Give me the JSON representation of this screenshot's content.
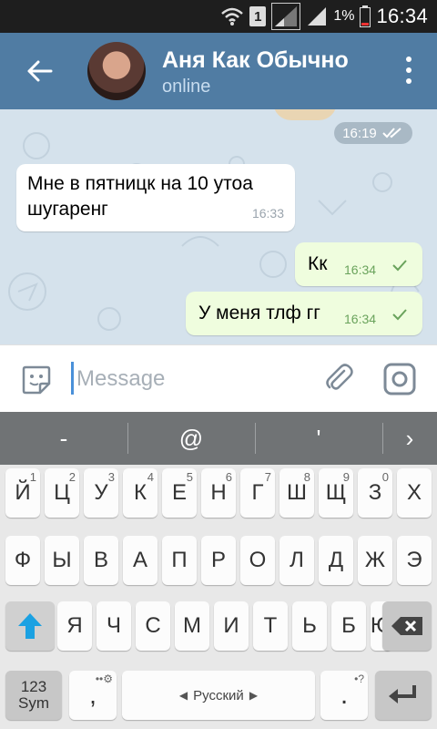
{
  "status_bar": {
    "sim": "1",
    "battery_pct": "1%",
    "time": "16:34"
  },
  "header": {
    "title": "Аня Как Обычно",
    "subtitle": "online"
  },
  "chat": {
    "date_time": "16:19",
    "messages": [
      {
        "dir": "in",
        "text": "Мне в пятницк на 10 утоа шугаренг",
        "time": "16:33"
      },
      {
        "dir": "out",
        "text": "Кк",
        "time": "16:34"
      },
      {
        "dir": "out",
        "text": "У меня тлф гг",
        "time": "16:34"
      }
    ]
  },
  "input": {
    "placeholder": "Message",
    "value": ""
  },
  "suggestions": [
    "-",
    "@",
    "'",
    "›"
  ],
  "keyboard": {
    "row1": [
      {
        "k": "Й",
        "s": "1"
      },
      {
        "k": "Ц",
        "s": "2"
      },
      {
        "k": "У",
        "s": "3"
      },
      {
        "k": "К",
        "s": "4"
      },
      {
        "k": "Е",
        "s": "5"
      },
      {
        "k": "Н",
        "s": "6"
      },
      {
        "k": "Г",
        "s": "7"
      },
      {
        "k": "Ш",
        "s": "8"
      },
      {
        "k": "Щ",
        "s": "9"
      },
      {
        "k": "З",
        "s": "0"
      },
      {
        "k": "Х",
        "s": ""
      }
    ],
    "row2": [
      "Ф",
      "Ы",
      "В",
      "А",
      "П",
      "Р",
      "О",
      "Л",
      "Д",
      "Ж",
      "Э"
    ],
    "row3": [
      "Я",
      "Ч",
      "С",
      "М",
      "И",
      "Т",
      "Ь",
      "Б",
      "Ю"
    ],
    "sym_label": "123\nSym",
    "comma": ",",
    "language": "Русский",
    "period": "."
  },
  "colors": {
    "header": "#507ca3",
    "out_bubble": "#effdde",
    "check": "#6aa35c"
  }
}
